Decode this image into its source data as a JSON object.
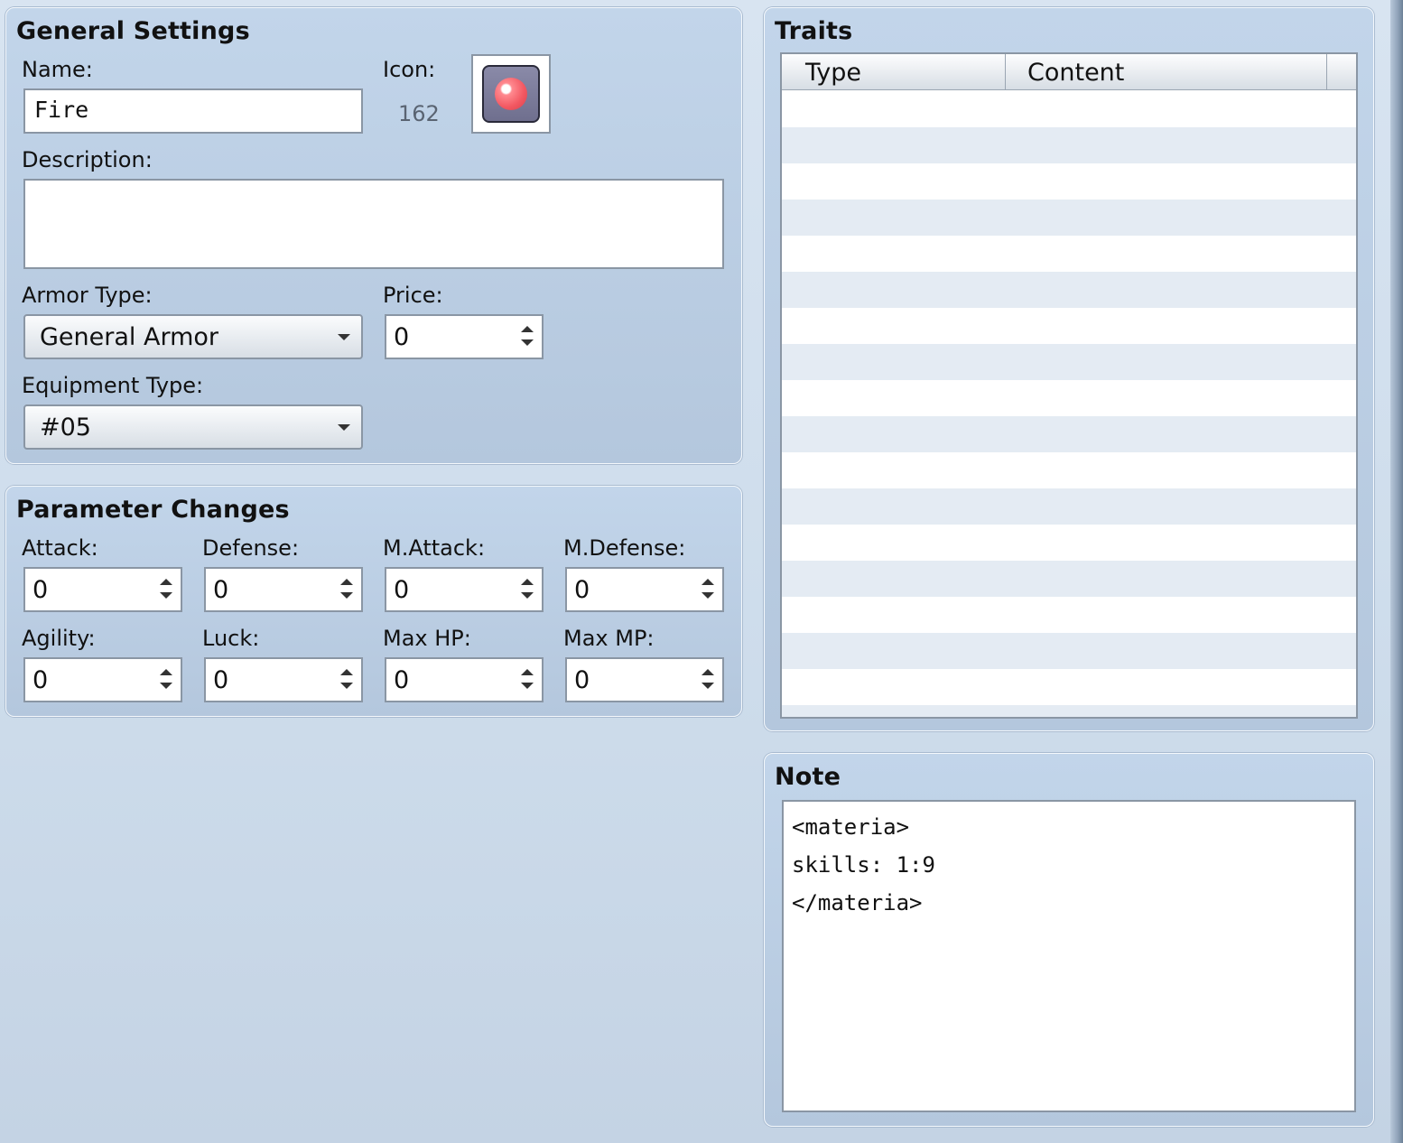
{
  "general": {
    "title": "General Settings",
    "name_label": "Name:",
    "name_value": "Fire",
    "icon_label": "Icon:",
    "icon_index": "162",
    "description_label": "Description:",
    "description_value": "",
    "armor_type_label": "Armor Type:",
    "armor_type_value": "General Armor",
    "price_label": "Price:",
    "price_value": "0",
    "equipment_type_label": "Equipment Type:",
    "equipment_type_value": "#05"
  },
  "params": {
    "title": "Parameter Changes",
    "fields": [
      {
        "label": "Attack:",
        "value": "0"
      },
      {
        "label": "Defense:",
        "value": "0"
      },
      {
        "label": "M.Attack:",
        "value": "0"
      },
      {
        "label": "M.Defense:",
        "value": "0"
      },
      {
        "label": "Agility:",
        "value": "0"
      },
      {
        "label": "Luck:",
        "value": "0"
      },
      {
        "label": "Max HP:",
        "value": "0"
      },
      {
        "label": "Max MP:",
        "value": "0"
      }
    ]
  },
  "traits": {
    "title": "Traits",
    "columns": [
      "Type",
      "Content"
    ],
    "rows": []
  },
  "note": {
    "title": "Note",
    "lines": [
      "<materia>",
      "skills: 1:9",
      "</materia>"
    ]
  }
}
